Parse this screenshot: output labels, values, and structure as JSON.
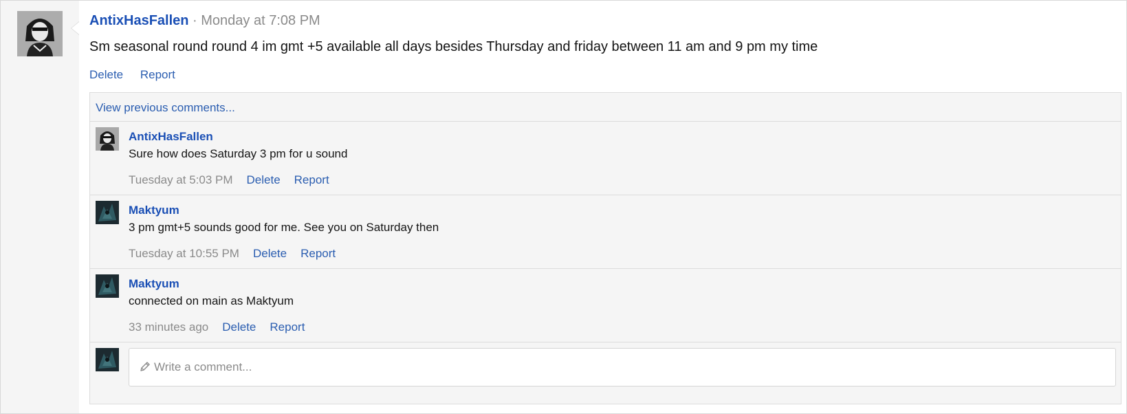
{
  "post": {
    "author": "AntixHasFallen",
    "separator": " · ",
    "time": "Monday at 7:08 PM",
    "body": "Sm seasonal round round 4 im gmt +5 available all days besides Thursday and friday between 11 am and 9 pm my time",
    "actions": {
      "delete": "Delete",
      "report": "Report"
    }
  },
  "comments": {
    "view_previous": "View previous comments...",
    "items": [
      {
        "author": "AntixHasFallen",
        "text": "Sure how does Saturday 3 pm for u sound",
        "time": "Tuesday at 5:03 PM",
        "delete": "Delete",
        "report": "Report"
      },
      {
        "author": "Maktyum",
        "text": "3 pm gmt+5 sounds good for me. See you on Saturday then",
        "time": "Tuesday at 10:55 PM",
        "delete": "Delete",
        "report": "Report"
      },
      {
        "author": "Maktyum",
        "text": "connected on main as Maktyum",
        "time": "33 minutes ago",
        "delete": "Delete",
        "report": "Report"
      }
    ],
    "composer": {
      "placeholder": "Write a comment...",
      "value": ""
    }
  },
  "colors": {
    "link": "#2a5db0",
    "username": "#1a4fb5",
    "muted": "#8a8a8a",
    "panel": "#f5f5f5"
  },
  "icons": {
    "composer": "pencil-icon"
  }
}
